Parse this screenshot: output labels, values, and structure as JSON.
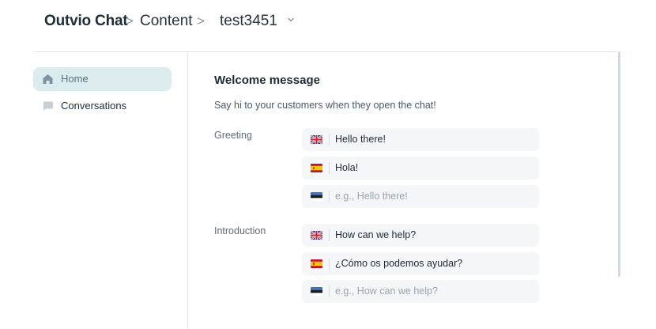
{
  "breadcrumb": {
    "app": "Outvio Chat",
    "separator": ">",
    "section": "Content",
    "shop": "test3451"
  },
  "sidebar": {
    "items": [
      {
        "label": "Home",
        "icon": "home-icon",
        "active": true
      },
      {
        "label": "Conversations",
        "icon": "chat-bubble-icon",
        "active": false
      }
    ]
  },
  "welcome": {
    "title": "Welcome message",
    "description": "Say hi to your customers when they open the chat!",
    "greeting": {
      "label": "Greeting",
      "entries": [
        {
          "flag": "uk-flag-icon",
          "value": "Hello there!",
          "placeholder": ""
        },
        {
          "flag": "spain-flag-icon",
          "value": "Hola!",
          "placeholder": ""
        },
        {
          "flag": "estonia-flag-icon",
          "value": "",
          "placeholder": "e.g., Hello there!"
        }
      ]
    },
    "introduction": {
      "label": "Introduction",
      "entries": [
        {
          "flag": "uk-flag-icon",
          "value": "How can we help?",
          "placeholder": ""
        },
        {
          "flag": "spain-flag-icon",
          "value": "¿Cómo os podemos ayudar?",
          "placeholder": ""
        },
        {
          "flag": "estonia-flag-icon",
          "value": "",
          "placeholder": "e.g., How can we help?"
        }
      ]
    }
  },
  "colors": {
    "active_nav_bg": "#dcebee",
    "input_bg": "#f4f6f8",
    "text_primary": "#1f2a37",
    "placeholder": "#9aa4ae"
  }
}
